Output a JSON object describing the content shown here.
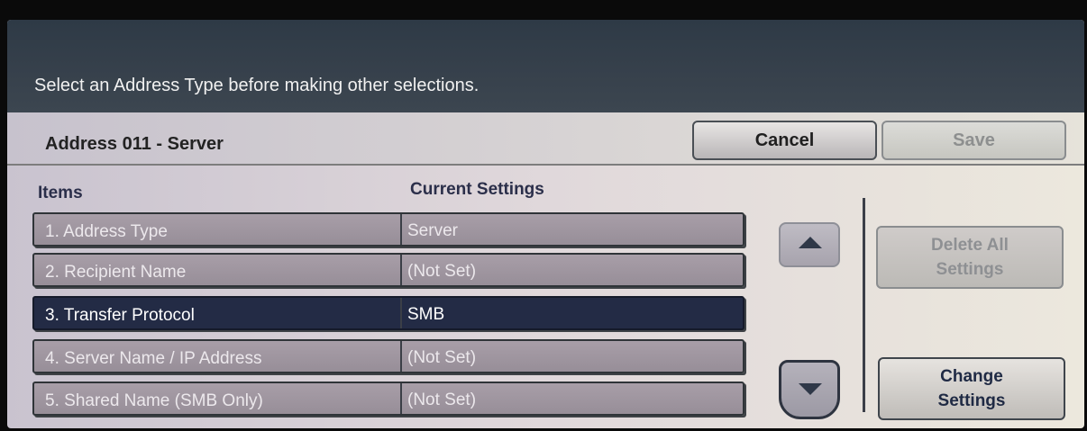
{
  "message": "Select an Address Type before making other selections.",
  "header": {
    "title": "Address 011 - Server",
    "cancel_label": "Cancel",
    "save_label": "Save"
  },
  "table": {
    "col_items": "Items",
    "col_current": "Current Settings",
    "rows": [
      {
        "num": "1.",
        "label": "Address Type",
        "value": "Server"
      },
      {
        "num": "2.",
        "label": "Recipient Name",
        "value": "(Not Set)"
      },
      {
        "num": "3.",
        "label": "Transfer Protocol",
        "value": "SMB"
      },
      {
        "num": "4.",
        "label": "Server Name / IP Address",
        "value": "(Not Set)"
      },
      {
        "num": "5.",
        "label": "Shared Name (SMB Only)",
        "value": "(Not Set)"
      }
    ],
    "selected_index": 2
  },
  "actions": {
    "delete_line1": "Delete All",
    "delete_line2": "Settings",
    "change_line1": "Change",
    "change_line2": "Settings"
  },
  "icons": {
    "scroll_up": "triangle-up-icon",
    "scroll_down": "triangle-down-icon"
  },
  "colors": {
    "message_bar": "#37414c",
    "selected_row": "#232b45",
    "row_bg": "#a89ea8",
    "header_text": "#2b2f4a"
  }
}
